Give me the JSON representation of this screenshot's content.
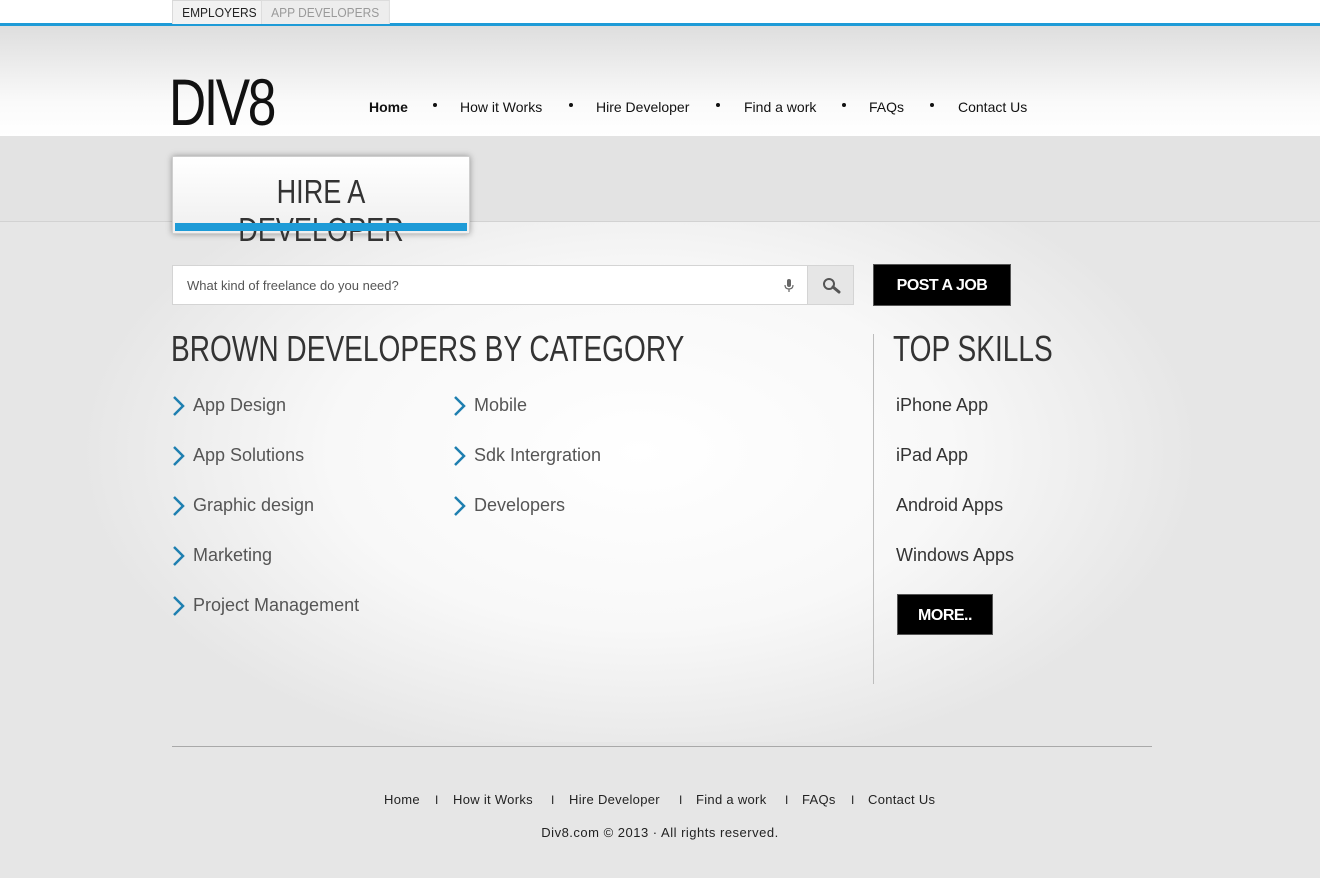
{
  "top_tabs": {
    "employers": "EMPLOYERS",
    "app_developers": "APP DEVELOPERS"
  },
  "logo": "DIV8",
  "nav": {
    "home": "Home",
    "how_it_works": "How it Works",
    "hire_developer": "Hire Developer",
    "find_a_work": "Find a work",
    "faqs": "FAQs",
    "contact_us": "Contact Us"
  },
  "page_title": "HIRE A DEVELOPER",
  "search": {
    "placeholder": "What kind of freelance do you need?",
    "value": ""
  },
  "post_job_label": "POST A JOB",
  "categories_title": "BROWN DEVELOPERS BY CATEGORY",
  "categories": {
    "col1": [
      "App Design",
      "App Solutions",
      "Graphic design",
      "Marketing",
      "Project Management"
    ],
    "col2": [
      "Mobile",
      "Sdk Intergration",
      "Developers"
    ]
  },
  "top_skills_title": "TOP SKILLS",
  "top_skills": [
    "iPhone App",
    "iPad App",
    "Android Apps",
    "Windows Apps"
  ],
  "more_label": "MORE..",
  "footer": {
    "nav": {
      "home": "Home",
      "how_it_works": "How it Works",
      "hire_developer": "Hire Developer",
      "find_a_work": "Find a work",
      "faqs": "FAQs",
      "contact_us": "Contact Us"
    },
    "separator": "I",
    "copyright": "Div8.com © 2013 · All rights reserved."
  },
  "colors": {
    "accent": "#1e9bd7",
    "button": "#000000",
    "chevron": "#1e7fb0"
  }
}
